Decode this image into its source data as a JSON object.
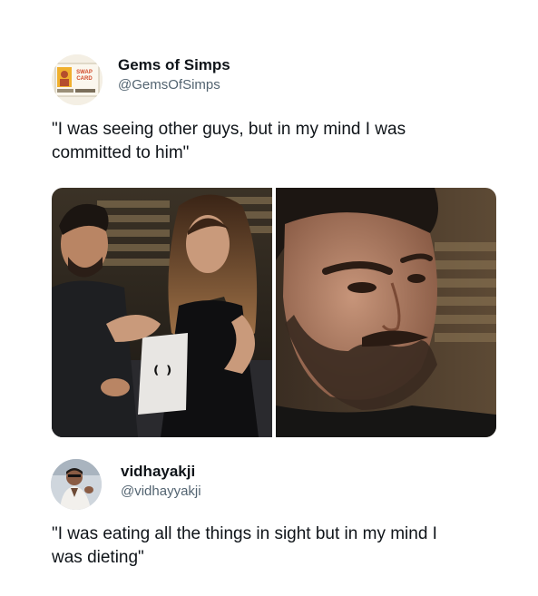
{
  "tweet1": {
    "display_name": "Gems of Simps",
    "handle": "@GemsOfSimps",
    "avatar_text": "SWAP CARD",
    "text": "\"I was seeing other guys, but in my mind I was\ncommitted to him\""
  },
  "tweet2": {
    "display_name": "vidhayakji",
    "handle": "@vidhayyakji",
    "text": "\"I was eating all the things in sight but in my mind I\nwas dieting\""
  },
  "colors": {
    "text_primary": "#0f1419",
    "text_secondary": "#536471",
    "background": "#ffffff"
  }
}
